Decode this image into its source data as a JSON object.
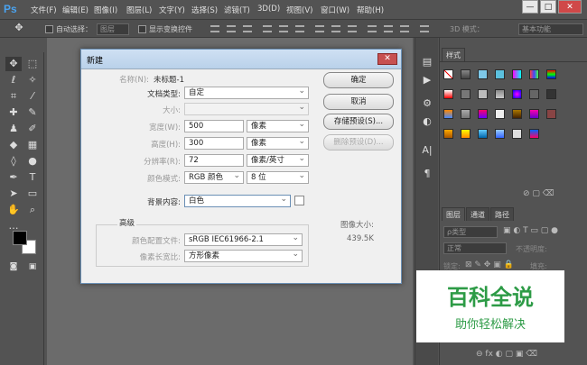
{
  "app": {
    "logo": "Ps"
  },
  "menu": [
    "文件(F)",
    "编辑(E)",
    "图像(I)",
    "图层(L)",
    "文字(Y)",
    "选择(S)",
    "滤镜(T)",
    "3D(D)",
    "视图(V)",
    "窗口(W)",
    "帮助(H)"
  ],
  "window_controls": {
    "minimize": "—",
    "restore": "□",
    "close": "✕"
  },
  "options": {
    "auto_select": "自动选择：",
    "auto_select_value": "图层",
    "show_transform": "显示变换控件",
    "mode_3d": "3D 模式：",
    "workspace": "基本功能"
  },
  "dialog": {
    "title": "新建",
    "close": "✕",
    "name_label": "名称(N):",
    "name_value": "未标题-1",
    "doctype_label": "文档类型:",
    "doctype_value": "自定",
    "size_label": "大小:",
    "width_label": "宽度(W):",
    "width_value": "500",
    "width_unit": "像素",
    "height_label": "高度(H):",
    "height_value": "300",
    "height_unit": "像素",
    "resolution_label": "分辨率(R):",
    "resolution_value": "72",
    "resolution_unit": "像素/英寸",
    "colormode_label": "颜色模式:",
    "colormode_value": "RGB 颜色",
    "colormode_bits": "8 位",
    "background_label": "背景内容:",
    "background_value": "白色",
    "advanced_label": "高级",
    "profile_label": "颜色配置文件:",
    "profile_value": "sRGB IEC61966-2.1",
    "pixel_aspect_label": "像素长宽比:",
    "pixel_aspect_value": "方形像素",
    "ok": "确定",
    "cancel": "取消",
    "save_preset": "存储预设(S)...",
    "delete_preset": "删除预设(D)...",
    "image_size_label": "图像大小:",
    "image_size_value": "439.5K"
  },
  "panels": {
    "styles_tab": "样式",
    "layers_tab": "图层",
    "channels_tab": "通道",
    "paths_tab": "路径",
    "kind": "ρ类型",
    "blend": "正常",
    "opacity": "不透明度:",
    "lock": "锁定:",
    "fill": "填充:"
  },
  "watermark": {
    "title": "百科全说",
    "subtitle": "助你轻松解决"
  },
  "colors": {
    "accent": "#4aa3f0",
    "watermark": "#2d9b46"
  }
}
